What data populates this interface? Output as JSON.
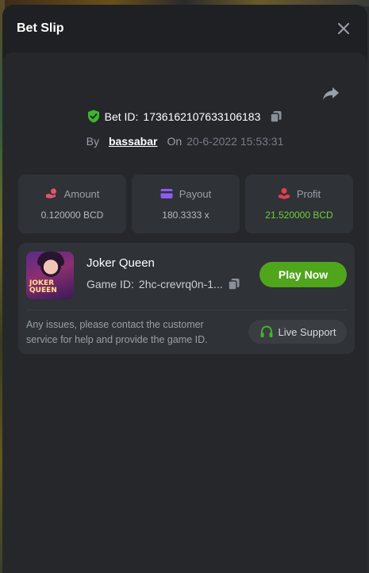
{
  "modal": {
    "title": "Bet Slip"
  },
  "bet": {
    "id_label": "Bet ID:",
    "id_value": "1736162107633106183",
    "by_label": "By",
    "username": "bassabar",
    "on_label": "On",
    "date": "20-6-2022 15:53:31"
  },
  "stats": [
    {
      "label": "Amount",
      "value": "0.120000 BCD",
      "icon": "hand-coin-icon"
    },
    {
      "label": "Payout",
      "value": "180.3333 x",
      "icon": "wallet-card-icon"
    },
    {
      "label": "Profit",
      "value": "21.520000 BCD",
      "icon": "profit-hand-icon"
    }
  ],
  "game": {
    "name": "Joker Queen",
    "thumb_text": "JOKER QUEEN",
    "id_label": "Game ID:",
    "id_value": "2hc-crevrq0n-1...",
    "play_label": "Play Now",
    "help_text": "Any issues, please contact the customer service for help and provide the game ID.",
    "support_label": "Live Support"
  },
  "colors": {
    "accent_green": "#4fa51c",
    "profit_green": "#6fd13a",
    "amount_icon": "#e0566a",
    "payout_icon": "#8a5cf0",
    "profit_icon": "#e0404a",
    "shield_green": "#3fb52a"
  }
}
